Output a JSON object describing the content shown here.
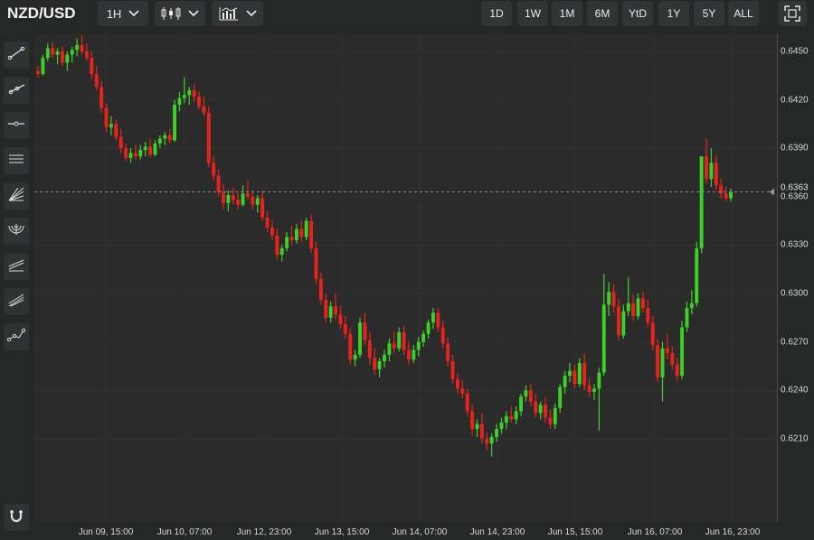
{
  "header": {
    "symbol": "NZD/USD",
    "interval": "1H",
    "ranges": [
      "1D",
      "1W",
      "1M",
      "6M",
      "YtD",
      "1Y",
      "5Y",
      "ALL"
    ]
  },
  "toolbar_icons": [
    "trend-line-icon",
    "ray-icon",
    "horizontal-line-icon",
    "parallel-channel-icon",
    "fib-fan-icon",
    "fib-arc-icon",
    "regression-channel-icon",
    "pitchfork-icon",
    "path-icon",
    "magnet-icon"
  ],
  "colors": {
    "up": "#3fcf2b",
    "down": "#e8231d",
    "background": "#2b2b2b",
    "grid": "#333333"
  },
  "chart_data": {
    "type": "candlestick",
    "symbol": "NZD/USD",
    "interval": "1H",
    "ylim": [
      0.619,
      0.6475
    ],
    "yticks": [
      "0.6450",
      "0.6420",
      "0.6390",
      "0.6360",
      "0.6330",
      "0.6300",
      "0.6270",
      "0.6240",
      "0.6210"
    ],
    "xticks": [
      "Jun 09, 15:00",
      "Jun 10, 07:00",
      "Jun 12, 23:00",
      "Jun 13, 15:00",
      "Jun 14, 07:00",
      "Jun 14, 23:00",
      "Jun 15, 15:00",
      "Jun 16, 07:00",
      "Jun 16, 23:00"
    ],
    "last_price": "0.6363",
    "candles": [
      [
        0.6438,
        0.6441,
        0.6434,
        0.6436
      ],
      [
        0.6436,
        0.6448,
        0.6435,
        0.6446
      ],
      [
        0.6446,
        0.6455,
        0.6444,
        0.6452
      ],
      [
        0.6452,
        0.6456,
        0.6446,
        0.6448
      ],
      [
        0.6448,
        0.6452,
        0.6442,
        0.645
      ],
      [
        0.645,
        0.6453,
        0.6441,
        0.6443
      ],
      [
        0.6443,
        0.645,
        0.6438,
        0.6448
      ],
      [
        0.6448,
        0.6453,
        0.6443,
        0.6451
      ],
      [
        0.6451,
        0.6458,
        0.6447,
        0.6454
      ],
      [
        0.6454,
        0.646,
        0.6448,
        0.645
      ],
      [
        0.645,
        0.6455,
        0.6444,
        0.6446
      ],
      [
        0.6446,
        0.645,
        0.6433,
        0.6436
      ],
      [
        0.6436,
        0.6441,
        0.6426,
        0.6428
      ],
      [
        0.6428,
        0.6432,
        0.6412,
        0.6415
      ],
      [
        0.6415,
        0.6418,
        0.64,
        0.6403
      ],
      [
        0.6403,
        0.641,
        0.6398,
        0.6405
      ],
      [
        0.6405,
        0.6408,
        0.6395,
        0.6397
      ],
      [
        0.6397,
        0.6402,
        0.6387,
        0.639
      ],
      [
        0.639,
        0.6393,
        0.6382,
        0.6384
      ],
      [
        0.6384,
        0.639,
        0.6381,
        0.6387
      ],
      [
        0.6387,
        0.6392,
        0.6383,
        0.6385
      ],
      [
        0.6385,
        0.6392,
        0.6383,
        0.6389
      ],
      [
        0.6389,
        0.6394,
        0.6385,
        0.6391
      ],
      [
        0.6391,
        0.6396,
        0.6384,
        0.6386
      ],
      [
        0.6386,
        0.6395,
        0.6385,
        0.6393
      ],
      [
        0.6393,
        0.6398,
        0.639,
        0.6396
      ],
      [
        0.6396,
        0.64,
        0.6392,
        0.6398
      ],
      [
        0.6398,
        0.6402,
        0.6393,
        0.6395
      ],
      [
        0.6395,
        0.642,
        0.6394,
        0.6417
      ],
      [
        0.6417,
        0.6425,
        0.6413,
        0.6421
      ],
      [
        0.6421,
        0.6434,
        0.6418,
        0.6423
      ],
      [
        0.6423,
        0.6428,
        0.6417,
        0.6426
      ],
      [
        0.6426,
        0.643,
        0.6419,
        0.6422
      ],
      [
        0.6422,
        0.6425,
        0.6414,
        0.6416
      ],
      [
        0.6416,
        0.6422,
        0.641,
        0.6412
      ],
      [
        0.6412,
        0.6416,
        0.6378,
        0.6381
      ],
      [
        0.6381,
        0.6385,
        0.637,
        0.6373
      ],
      [
        0.6373,
        0.6377,
        0.636,
        0.6363
      ],
      [
        0.6363,
        0.6368,
        0.6352,
        0.6356
      ],
      [
        0.6356,
        0.6364,
        0.6351,
        0.6361
      ],
      [
        0.6361,
        0.6366,
        0.6355,
        0.6358
      ],
      [
        0.6358,
        0.6363,
        0.6352,
        0.6355
      ],
      [
        0.6355,
        0.6367,
        0.6354,
        0.6362
      ],
      [
        0.6362,
        0.637,
        0.6358,
        0.636
      ],
      [
        0.636,
        0.6364,
        0.6352,
        0.6355
      ],
      [
        0.6355,
        0.6361,
        0.635,
        0.6359
      ],
      [
        0.6359,
        0.6364,
        0.6345,
        0.6347
      ],
      [
        0.6347,
        0.6351,
        0.6338,
        0.6341
      ],
      [
        0.6341,
        0.6345,
        0.6333,
        0.6336
      ],
      [
        0.6336,
        0.634,
        0.6321,
        0.6324
      ],
      [
        0.6324,
        0.633,
        0.632,
        0.6328
      ],
      [
        0.6328,
        0.6338,
        0.6326,
        0.6335
      ],
      [
        0.6335,
        0.6342,
        0.633,
        0.6333
      ],
      [
        0.6333,
        0.6343,
        0.6331,
        0.634
      ],
      [
        0.634,
        0.6345,
        0.6332,
        0.6335
      ],
      [
        0.6335,
        0.6347,
        0.6333,
        0.6345
      ],
      [
        0.6345,
        0.6349,
        0.6325,
        0.6328
      ],
      [
        0.6328,
        0.6332,
        0.6306,
        0.6309
      ],
      [
        0.6309,
        0.6313,
        0.6293,
        0.6296
      ],
      [
        0.6296,
        0.63,
        0.6282,
        0.6285
      ],
      [
        0.6285,
        0.6295,
        0.6282,
        0.6292
      ],
      [
        0.6292,
        0.63,
        0.6284,
        0.6287
      ],
      [
        0.6287,
        0.6292,
        0.6278,
        0.6281
      ],
      [
        0.6281,
        0.6286,
        0.6272,
        0.6275
      ],
      [
        0.6275,
        0.6279,
        0.6256,
        0.6259
      ],
      [
        0.6259,
        0.6265,
        0.6255,
        0.6262
      ],
      [
        0.6262,
        0.6285,
        0.626,
        0.6282
      ],
      [
        0.6282,
        0.6288,
        0.6268,
        0.6271
      ],
      [
        0.6271,
        0.6276,
        0.6256,
        0.626
      ],
      [
        0.626,
        0.6266,
        0.625,
        0.6253
      ],
      [
        0.6253,
        0.626,
        0.6248,
        0.6258
      ],
      [
        0.6258,
        0.6265,
        0.6254,
        0.6262
      ],
      [
        0.6262,
        0.6272,
        0.6258,
        0.6269
      ],
      [
        0.6269,
        0.6277,
        0.6263,
        0.6266
      ],
      [
        0.6266,
        0.6279,
        0.6264,
        0.6276
      ],
      [
        0.6276,
        0.628,
        0.6262,
        0.6265
      ],
      [
        0.6265,
        0.627,
        0.6256,
        0.6259
      ],
      [
        0.6259,
        0.6268,
        0.6257,
        0.6265
      ],
      [
        0.6265,
        0.6273,
        0.6261,
        0.627
      ],
      [
        0.627,
        0.6277,
        0.6267,
        0.6275
      ],
      [
        0.6275,
        0.6284,
        0.6272,
        0.6282
      ],
      [
        0.6282,
        0.6291,
        0.6278,
        0.6288
      ],
      [
        0.6288,
        0.6291,
        0.6276,
        0.6279
      ],
      [
        0.6279,
        0.6283,
        0.6266,
        0.6269
      ],
      [
        0.6269,
        0.6273,
        0.6255,
        0.6258
      ],
      [
        0.6258,
        0.6262,
        0.6244,
        0.6247
      ],
      [
        0.6247,
        0.6251,
        0.6238,
        0.6241
      ],
      [
        0.6241,
        0.6246,
        0.6235,
        0.6238
      ],
      [
        0.6238,
        0.6241,
        0.6224,
        0.6227
      ],
      [
        0.6227,
        0.6231,
        0.6212,
        0.6216
      ],
      [
        0.6216,
        0.6222,
        0.6211,
        0.6219
      ],
      [
        0.6219,
        0.6226,
        0.6207,
        0.621
      ],
      [
        0.621,
        0.6214,
        0.6203,
        0.6207
      ],
      [
        0.6207,
        0.6213,
        0.6199,
        0.6211
      ],
      [
        0.6211,
        0.6219,
        0.6208,
        0.6216
      ],
      [
        0.6216,
        0.6223,
        0.6213,
        0.622
      ],
      [
        0.622,
        0.6227,
        0.6216,
        0.6224
      ],
      [
        0.6224,
        0.623,
        0.622,
        0.6222
      ],
      [
        0.6222,
        0.623,
        0.6219,
        0.6227
      ],
      [
        0.6227,
        0.6238,
        0.6224,
        0.6236
      ],
      [
        0.6236,
        0.6243,
        0.6233,
        0.624
      ],
      [
        0.624,
        0.6244,
        0.623,
        0.6233
      ],
      [
        0.6233,
        0.6238,
        0.6223,
        0.6226
      ],
      [
        0.6226,
        0.6233,
        0.6222,
        0.6231
      ],
      [
        0.6231,
        0.6236,
        0.622,
        0.6223
      ],
      [
        0.6223,
        0.6228,
        0.6216,
        0.6219
      ],
      [
        0.6219,
        0.6232,
        0.6216,
        0.6229
      ],
      [
        0.6229,
        0.6244,
        0.6226,
        0.6242
      ],
      [
        0.6242,
        0.6252,
        0.6238,
        0.6249
      ],
      [
        0.6249,
        0.6257,
        0.6245,
        0.6252
      ],
      [
        0.6252,
        0.6256,
        0.6241,
        0.6244
      ],
      [
        0.6244,
        0.626,
        0.6242,
        0.6257
      ],
      [
        0.6257,
        0.6263,
        0.624,
        0.6243
      ],
      [
        0.6243,
        0.6248,
        0.6236,
        0.6239
      ],
      [
        0.6239,
        0.6244,
        0.6234,
        0.6241
      ],
      [
        0.6241,
        0.6254,
        0.6215,
        0.6251
      ],
      [
        0.6251,
        0.6312,
        0.6249,
        0.6293
      ],
      [
        0.6293,
        0.6307,
        0.6286,
        0.6301
      ],
      [
        0.6301,
        0.6306,
        0.6288,
        0.6292
      ],
      [
        0.6292,
        0.6297,
        0.6271,
        0.6274
      ],
      [
        0.6274,
        0.6293,
        0.6272,
        0.6289
      ],
      [
        0.6289,
        0.631,
        0.6286,
        0.6294
      ],
      [
        0.6294,
        0.6299,
        0.6283,
        0.6286
      ],
      [
        0.6286,
        0.63,
        0.6284,
        0.6297
      ],
      [
        0.6297,
        0.6301,
        0.6288,
        0.6291
      ],
      [
        0.6291,
        0.6296,
        0.6279,
        0.6282
      ],
      [
        0.6282,
        0.6286,
        0.6265,
        0.6268
      ],
      [
        0.6268,
        0.6272,
        0.6245,
        0.6248
      ],
      [
        0.6248,
        0.627,
        0.6233,
        0.6266
      ],
      [
        0.6266,
        0.6275,
        0.6259,
        0.6263
      ],
      [
        0.6263,
        0.6267,
        0.6253,
        0.6256
      ],
      [
        0.6256,
        0.626,
        0.6246,
        0.6249
      ],
      [
        0.6249,
        0.6283,
        0.6247,
        0.6279
      ],
      [
        0.6279,
        0.6295,
        0.6276,
        0.6291
      ],
      [
        0.6291,
        0.6302,
        0.6287,
        0.6294
      ],
      [
        0.6294,
        0.6332,
        0.6292,
        0.6328
      ],
      [
        0.6328,
        0.6382,
        0.6325,
        0.6385
      ],
      [
        0.6385,
        0.6396,
        0.6368,
        0.6371
      ],
      [
        0.6371,
        0.639,
        0.6366,
        0.6381
      ],
      [
        0.6381,
        0.6386,
        0.6364,
        0.6367
      ],
      [
        0.6367,
        0.6371,
        0.6359,
        0.6362
      ],
      [
        0.6362,
        0.6366,
        0.6357,
        0.6359
      ],
      [
        0.6359,
        0.6365,
        0.6357,
        0.6363
      ]
    ]
  }
}
